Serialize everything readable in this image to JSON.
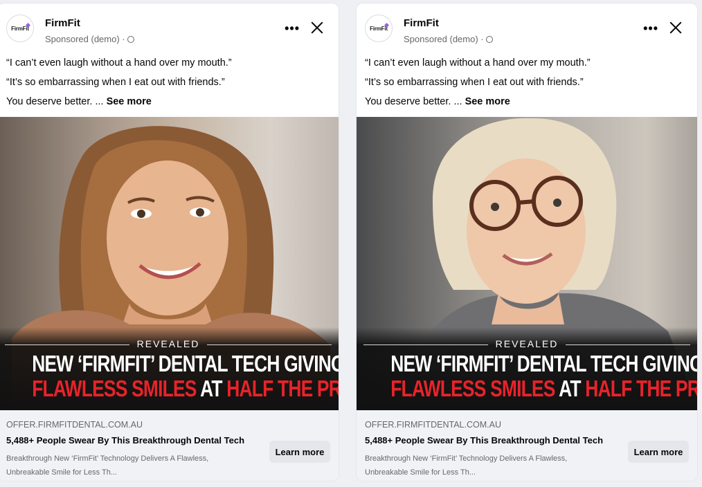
{
  "colors": {
    "accent_red": "#e8232a",
    "banner": "#111111",
    "footer_bg": "#f0f2f5"
  },
  "ads": [
    {
      "page_name": "FirmFit",
      "avatar_text": "FirmFit",
      "sponsored": "Sponsored (demo) · ",
      "line1": "“I can’t even laugh without a hand over my mouth.”",
      "line2": "“It’s so embarrassing when I eat out with friends.”",
      "line3": "You deserve better. ... ",
      "see_more": "See more",
      "revealed": "REVEALED",
      "headline1": "NEW ‘FIRMFIT’ DENTAL TECH GIVING",
      "headline2a": "FLAWLESS SMILES",
      "headline2b": " AT ",
      "headline2c": "HALF THE PRICE",
      "domain": "OFFER.FIRMFITDENTAL.COM.AU",
      "title": "5,488+ People Swear By This Breakthrough Dental Tech",
      "desc": "Breakthrough New ‘FirmFit’ Technology Delivers A Flawless, Unbreakable Smile for Less Th...",
      "cta": "Learn more",
      "more_icon": "more-options-icon",
      "close_icon": "close-icon"
    },
    {
      "page_name": "FirmFit",
      "avatar_text": "FirmFit",
      "sponsored": "Sponsored (demo) · ",
      "line1": "“I can’t even laugh without a hand over my mouth.”",
      "line2": "“It’s so embarrassing when I eat out with friends.”",
      "line3": "You deserve better. ... ",
      "see_more": "See more",
      "revealed": "REVEALED",
      "headline1": "NEW ‘FIRMFIT’ DENTAL TECH GIVING",
      "headline2a": "FLAWLESS SMILES",
      "headline2b": " AT ",
      "headline2c": "HALF THE PRICE",
      "domain": "OFFER.FIRMFITDENTAL.COM.AU",
      "title": "5,488+ People Swear By This Breakthrough Dental Tech",
      "desc": "Breakthrough New ‘FirmFit’ Technology Delivers A Flawless, Unbreakable Smile for Less Th...",
      "cta": "Learn more",
      "more_icon": "more-options-icon",
      "close_icon": "close-icon"
    }
  ]
}
